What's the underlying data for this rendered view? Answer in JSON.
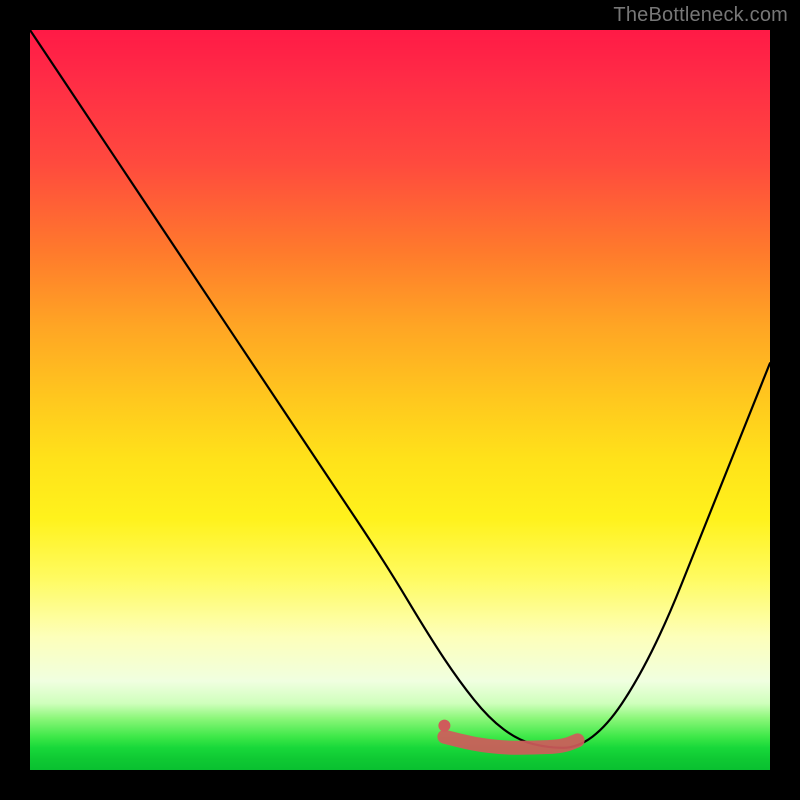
{
  "watermark": "TheBottleneck.com",
  "chart_data": {
    "type": "line",
    "title": "",
    "xlabel": "",
    "ylabel": "",
    "xlim": [
      0,
      100
    ],
    "ylim": [
      0,
      100
    ],
    "background_gradient": {
      "top": "#ff1a46",
      "mid": "#ffe21a",
      "bottom": "#09c030"
    },
    "series": [
      {
        "name": "curve",
        "x": [
          0,
          8,
          16,
          24,
          32,
          40,
          48,
          54,
          58,
          62,
          66,
          70,
          74,
          78,
          82,
          86,
          90,
          94,
          98,
          100
        ],
        "y": [
          100,
          88,
          76,
          64,
          52,
          40,
          28,
          18,
          12,
          7,
          4,
          3,
          3,
          6,
          12,
          20,
          30,
          40,
          50,
          55
        ],
        "note": "y is percent height from bottom; curve descends from top-left, bottoms out ~65-73% across, then rises to mid-right"
      },
      {
        "name": "highlight-segment",
        "x": [
          56,
          60,
          64,
          68,
          72,
          74
        ],
        "y": [
          4.5,
          3.5,
          3,
          3,
          3.2,
          4
        ],
        "color": "#cf5b5b",
        "note": "thick reddish stroke along the trough of the curve"
      }
    ],
    "annotations": [
      {
        "name": "highlight-dot",
        "x": 56,
        "y": 6,
        "color": "#cf5b5b"
      }
    ]
  }
}
